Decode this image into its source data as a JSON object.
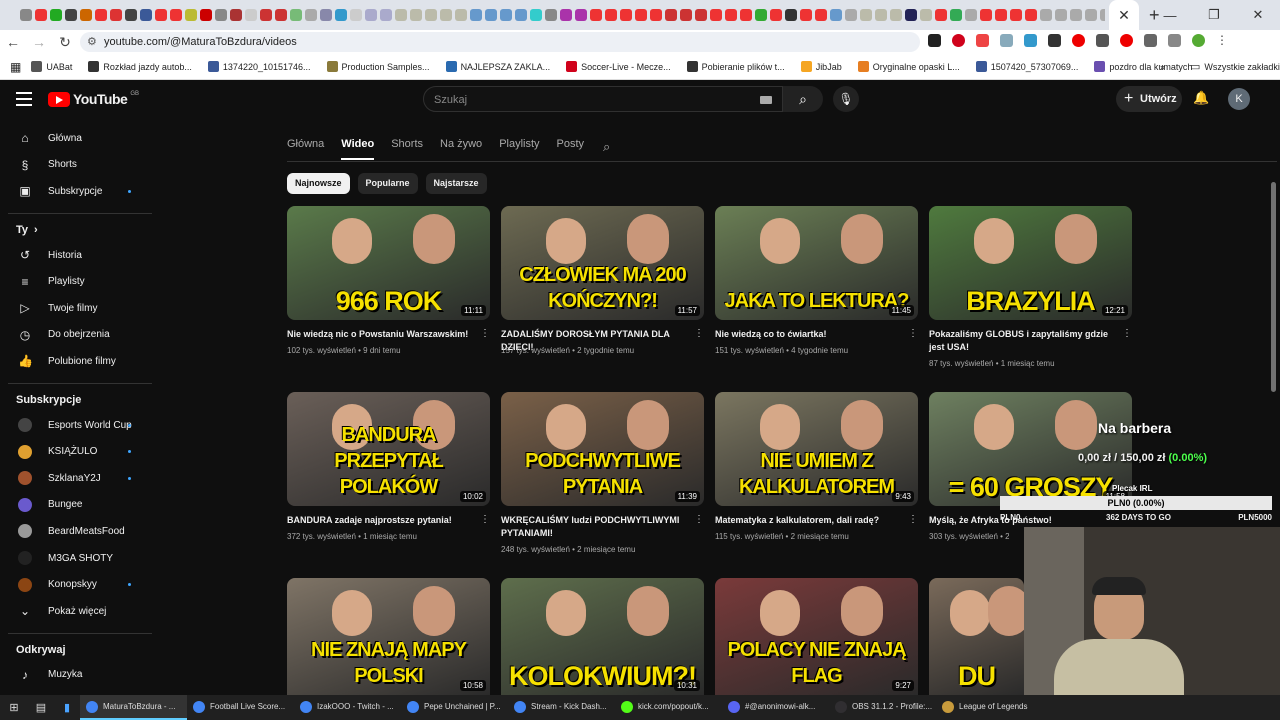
{
  "browser": {
    "tab_title": "MaturaToBzdura - YouTube",
    "url": "youtube.com/@MaturaToBzdura/videos",
    "bookmarks": [
      {
        "label": "UABat",
        "color": "#555"
      },
      {
        "label": "Rozkład jazdy autob...",
        "color": "#333"
      },
      {
        "label": "1374220_10151746...",
        "color": "#3b5998"
      },
      {
        "label": "Production Samples...",
        "color": "#8a7a3a"
      },
      {
        "label": "NAJLEPSZA ZAKLA...",
        "color": "#2a6ab0"
      },
      {
        "label": "Soccer-Live - Mecze...",
        "color": "#d0021b"
      },
      {
        "label": "Pobieranie plików t...",
        "color": "#333"
      },
      {
        "label": "JibJab",
        "color": "#f5a623"
      },
      {
        "label": "Oryginalne opaski L...",
        "color": "#e67e22"
      },
      {
        "label": "1507420_57307069...",
        "color": "#3b5998"
      },
      {
        "label": "pozdro dla kumatych",
        "color": "#6a4fb0"
      }
    ],
    "bookmarks_more": "Wszystkie zakładki"
  },
  "youtube": {
    "logo_text": "YouTube",
    "logo_region": "GB",
    "search_placeholder": "Szukaj",
    "create_label": "Utwórz",
    "avatar_letter": "K"
  },
  "sidebar": {
    "main": [
      {
        "label": "Główna",
        "icon": "home-icon",
        "glyph": "⌂"
      },
      {
        "label": "Shorts",
        "icon": "shorts-icon",
        "glyph": "§"
      },
      {
        "label": "Subskrypcje",
        "icon": "subscriptions-icon",
        "glyph": "▣"
      }
    ],
    "you_title": "Ty",
    "you": [
      {
        "label": "Historia",
        "icon": "history-icon",
        "glyph": "↺"
      },
      {
        "label": "Playlisty",
        "icon": "playlists-icon",
        "glyph": "≡"
      },
      {
        "label": "Twoje filmy",
        "icon": "your-videos-icon",
        "glyph": "▷"
      },
      {
        "label": "Do obejrzenia",
        "icon": "watch-later-icon",
        "glyph": "◷"
      },
      {
        "label": "Polubione filmy",
        "icon": "liked-icon",
        "glyph": "👍"
      }
    ],
    "subs_title": "Subskrypcje",
    "subs": [
      {
        "label": "Esports World Cup",
        "color": "#444"
      },
      {
        "label": "KSIĄŻULO",
        "color": "#e0a030"
      },
      {
        "label": "SzklanaY2J",
        "color": "#a0522d"
      },
      {
        "label": "Bungee",
        "color": "#6a5acd"
      },
      {
        "label": "BeardMeatsFood",
        "color": "#999"
      },
      {
        "label": "M3GA SHOTY",
        "color": "#222"
      },
      {
        "label": "Konopskyy",
        "color": "#8b4513"
      }
    ],
    "show_more": "Pokaż więcej",
    "explore_title": "Odkrywaj",
    "explore": [
      {
        "label": "Muzyka",
        "icon": "music-icon",
        "glyph": "♪"
      }
    ]
  },
  "channel_tabs": [
    "Główna",
    "Wideo",
    "Shorts",
    "Na żywo",
    "Playlisty",
    "Posty"
  ],
  "active_tab": "Wideo",
  "chips": [
    "Najnowsze",
    "Popularne",
    "Najstarsze"
  ],
  "videos": [
    {
      "title": "Nie wiedzą nic o Powstaniu Warszawskim!",
      "meta": "102 tys. wyświetleń • 9 dni temu",
      "duration": "11:11",
      "caption": "966 ROK",
      "bg": "#5a7a4a"
    },
    {
      "title": "ZADALIŚMY DOROSŁYM PYTANIA DLA DZIECI!",
      "meta": "157 tys. wyświetleń • 2 tygodnie temu",
      "duration": "11:57",
      "caption": "CZŁOWIEK MA 200 KOŃCZYN?!",
      "bg": "#6d6a52"
    },
    {
      "title": "Nie wiedzą co to ćwiartka!",
      "meta": "151 tys. wyświetleń • 4 tygodnie temu",
      "duration": "11:45",
      "caption": "JAKA TO LEKTURA?",
      "bg": "#6b7f55"
    },
    {
      "title": "Pokazaliśmy GLOBUS i zapytaliśmy gdzie jest USA!",
      "meta": "87 tys. wyświetleń • 1 miesiąc temu",
      "duration": "12:21",
      "caption": "BRAZYLIA",
      "bg": "#4f7a3e"
    },
    {
      "title": "BANDURA zadaje najprostsze pytania!",
      "meta": "372 tys. wyświetleń • 1 miesiąc temu",
      "duration": "10:02",
      "caption": "BANDURA PRZEPYTAŁ POLAKÓW",
      "bg": "#6a5f58"
    },
    {
      "title": "WKRĘCALIŚMY ludzi PODCHWYTLIWYMI PYTANIAMI!",
      "meta": "248 tys. wyświetleń • 2 miesiące temu",
      "duration": "11:39",
      "caption": "PODCHWYTLIWE PYTANIA",
      "bg": "#7a6048"
    },
    {
      "title": "Matematyka z kalkulatorem, dali radę?",
      "meta": "115 tys. wyświetleń • 2 miesiące temu",
      "duration": "9:43",
      "caption": "NIE UMIEM Z KALKULATOREM",
      "bg": "#7b7660"
    },
    {
      "title": "Myślą, że Afryka to państwo!",
      "meta": "303 tys. wyświetleń • 2 miesiące temu",
      "duration": "11:58",
      "caption": "= 60 GROSZY",
      "bg": "#6e8060"
    },
    {
      "title": "",
      "meta": "",
      "duration": "10:58",
      "caption": "NIE ZNAJĄ MAPY POLSKI",
      "bg": "#7f7466"
    },
    {
      "title": "",
      "meta": "",
      "duration": "10:31",
      "caption": "KOLOKWIUM?!",
      "bg": "#5e6e4c"
    },
    {
      "title": "",
      "meta": "",
      "duration": "9:27",
      "caption": "POLACY NIE ZNAJĄ FLAG",
      "bg": "#7a3a3a"
    },
    {
      "title": "",
      "meta": "",
      "duration": "",
      "caption": "DU",
      "bg": "#7a6a5a"
    }
  ],
  "overlay": {
    "name": "Na barbera",
    "amount": "0,00 zł / 150,00 zł",
    "percent": "(0.00%)",
    "goal_title": "Plecak IRL",
    "goal_bar": "PLN0 (0.00%)",
    "goal_left": "PLN0",
    "goal_center": "362 DAYS TO GO",
    "goal_right": "PLN5000"
  },
  "taskbar": [
    {
      "label": "MaturaToBzdura - ...",
      "color": "#4285f4",
      "active": true
    },
    {
      "label": "Football Live Score...",
      "color": "#4285f4"
    },
    {
      "label": "IzakOOO - Twitch - ...",
      "color": "#4285f4"
    },
    {
      "label": "Pepe Unchained | P...",
      "color": "#4285f4"
    },
    {
      "label": "Stream - Kick Dash...",
      "color": "#4285f4"
    },
    {
      "label": "kick.com/popout/k...",
      "color": "#53fc18"
    },
    {
      "label": "#@anonimowi-alk...",
      "color": "#5865f2"
    },
    {
      "label": "OBS 31.1.2 - Profile:...",
      "color": "#302e31"
    },
    {
      "label": "League of Legends",
      "color": "#c89b3c"
    }
  ]
}
